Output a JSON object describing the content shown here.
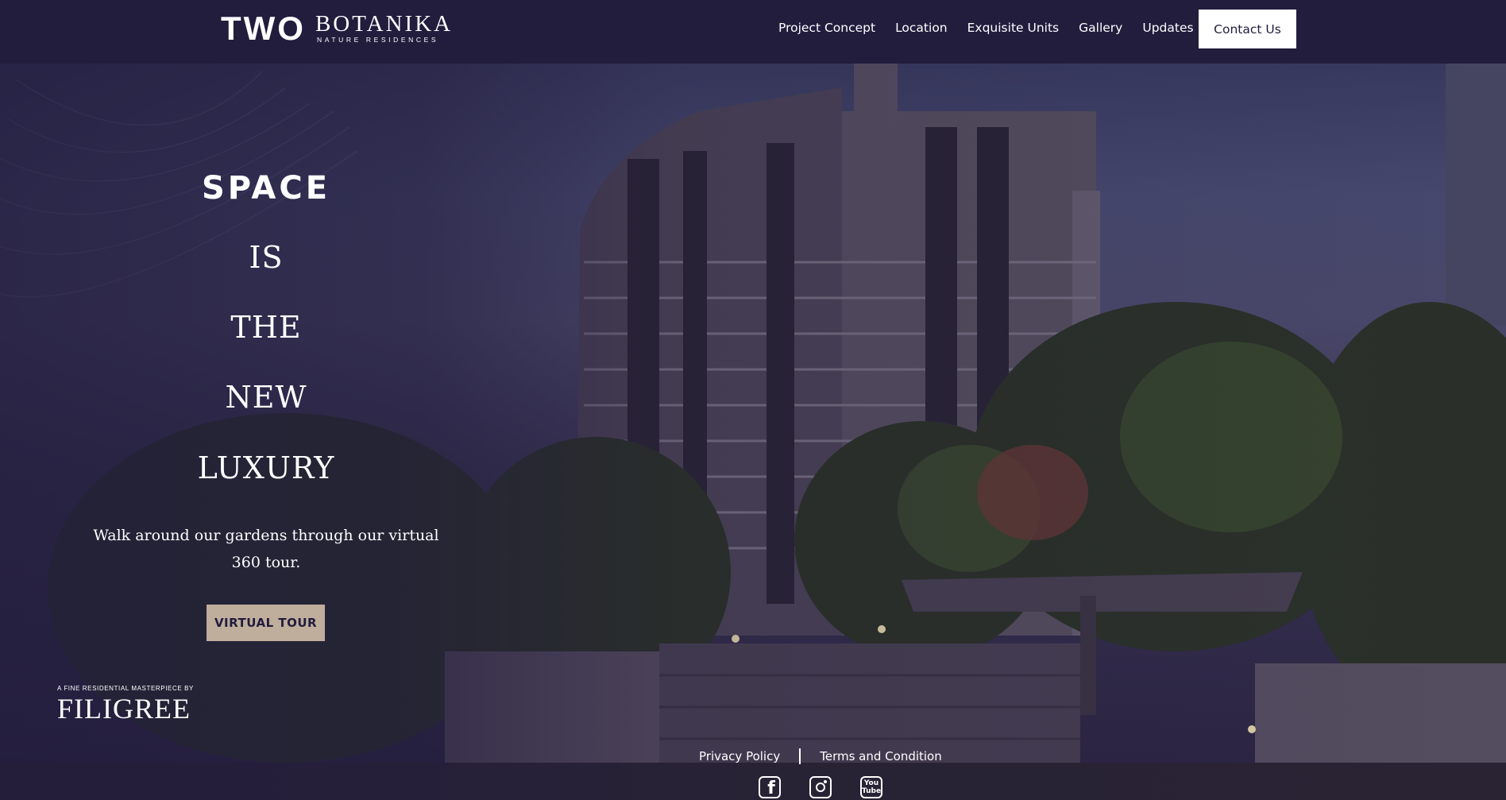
{
  "header": {
    "logo_main": "TWO",
    "logo_name": "BOTANIKA",
    "logo_tagline": "NATURE RESIDENCES",
    "nav_items": [
      "Project Concept",
      "Location",
      "Exquisite Units",
      "Gallery",
      "Updates"
    ],
    "contact_label": "Contact Us"
  },
  "hero": {
    "headline_1": "SPACE",
    "headline_2": "IS",
    "headline_3": "THE",
    "headline_4": "NEW",
    "headline_5": "LUXURY",
    "description": "Walk around our gardens through our virtual 360 tour.",
    "cta_label": "VIRTUAL TOUR"
  },
  "footer": {
    "developer_tagline": "A FINE RESIDENTIAL MASTERPIECE BY",
    "developer_name": "FILIGREE",
    "links": [
      "Privacy Policy",
      "Terms and Condition"
    ],
    "social": {
      "facebook_glyph": "f",
      "youtube_label_top": "You",
      "youtube_label_bottom": "Tube"
    }
  },
  "colors": {
    "brand_navy": "#221c3d",
    "button_beige": "#bfae9c",
    "white": "#ffffff"
  }
}
